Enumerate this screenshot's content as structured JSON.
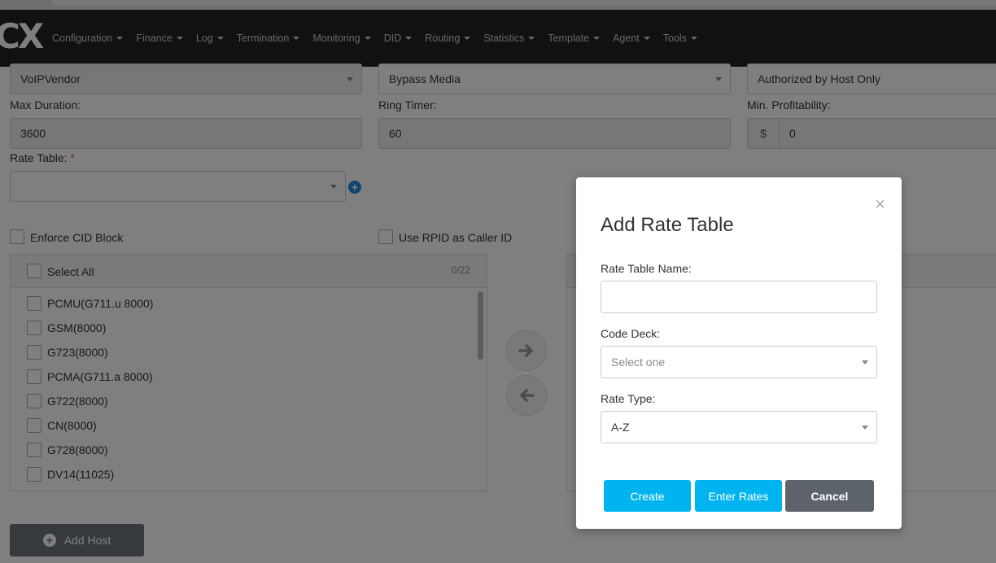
{
  "nav": {
    "logo": "CX",
    "items": [
      {
        "label": "Configuration"
      },
      {
        "label": "Finance"
      },
      {
        "label": "Log"
      },
      {
        "label": "Termination"
      },
      {
        "label": "Monitoring"
      },
      {
        "label": "DID"
      },
      {
        "label": "Routing"
      },
      {
        "label": "Statistics"
      },
      {
        "label": "Template"
      },
      {
        "label": "Agent"
      },
      {
        "label": "Tools"
      }
    ]
  },
  "form": {
    "vendor_select": "VoIPVendor",
    "media_select": "Bypass Media",
    "auth_select": "Authorized by Host Only",
    "max_duration_label": "Max Duration:",
    "max_duration_value": "3600",
    "ring_timer_label": "Ring Timer:",
    "ring_timer_value": "60",
    "min_profit_label": "Min. Profitability:",
    "min_profit_addon": "$",
    "min_profit_value": "0",
    "rate_table_label": "Rate Table:",
    "required_mark": "*",
    "enforce_cid_label": "Enforce CID Block",
    "use_rpid_label": "Use RPID as Caller ID"
  },
  "codecs": {
    "select_all_label": "Select All",
    "count": "0/22",
    "items": [
      {
        "label": "PCMU(G711.u 8000)"
      },
      {
        "label": "GSM(8000)"
      },
      {
        "label": "G723(8000)"
      },
      {
        "label": "PCMA(G711.a 8000)"
      },
      {
        "label": "G722(8000)"
      },
      {
        "label": "CN(8000)"
      },
      {
        "label": "G728(8000)"
      },
      {
        "label": "DV14(11025)"
      }
    ]
  },
  "add_host_label": "Add Host",
  "modal": {
    "title": "Add Rate Table",
    "close_symbol": "×",
    "name_label": "Rate Table Name:",
    "name_value": "",
    "code_deck_label": "Code Deck:",
    "code_deck_placeholder": "Select one",
    "rate_type_label": "Rate Type:",
    "rate_type_value": "A-Z",
    "create_label": "Create",
    "enter_rates_label": "Enter Rates",
    "cancel_label": "Cancel"
  },
  "colors": {
    "navbar": "#222222",
    "primary_button": "#00b4f0",
    "cancel_button": "#5c636a",
    "plus_icon": "#1a8fe0"
  }
}
